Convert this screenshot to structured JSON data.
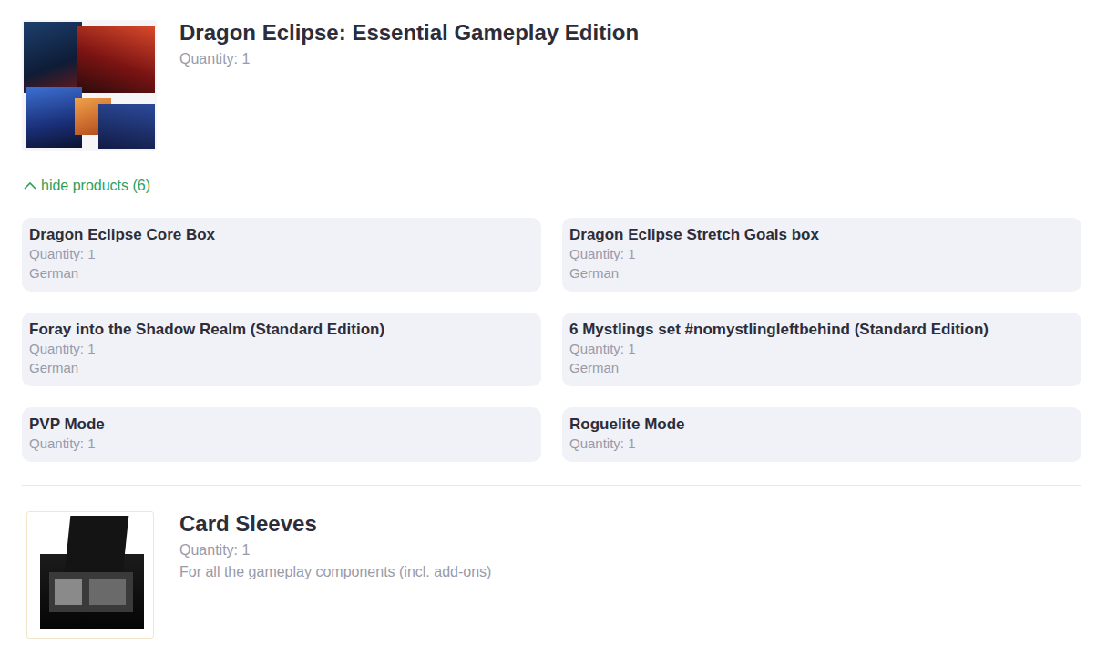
{
  "products": [
    {
      "kind": "bundle",
      "title": "Dragon Eclipse: Essential Gameplay Edition",
      "quantity": "Quantity: 1",
      "toggle": {
        "label": "hide products (6)",
        "expanded": true
      },
      "items": [
        {
          "title": "Dragon Eclipse Core Box",
          "quantity": "Quantity: 1",
          "language": "German"
        },
        {
          "title": "Dragon Eclipse Stretch Goals box",
          "quantity": "Quantity: 1",
          "language": "German"
        },
        {
          "title": "Foray into the Shadow Realm (Standard Edition)",
          "quantity": "Quantity: 1",
          "language": "German"
        },
        {
          "title": "6 Mystlings set #nomystlingleftbehind (Standard Edition)",
          "quantity": "Quantity: 1",
          "language": "German"
        },
        {
          "title": "PVP Mode",
          "quantity": "Quantity: 1"
        },
        {
          "title": "Roguelite Mode",
          "quantity": "Quantity: 1"
        }
      ]
    },
    {
      "kind": "single",
      "title": "Card Sleeves",
      "quantity": "Quantity: 1",
      "description": "For all the gameplay components (incl. add-ons)"
    }
  ]
}
